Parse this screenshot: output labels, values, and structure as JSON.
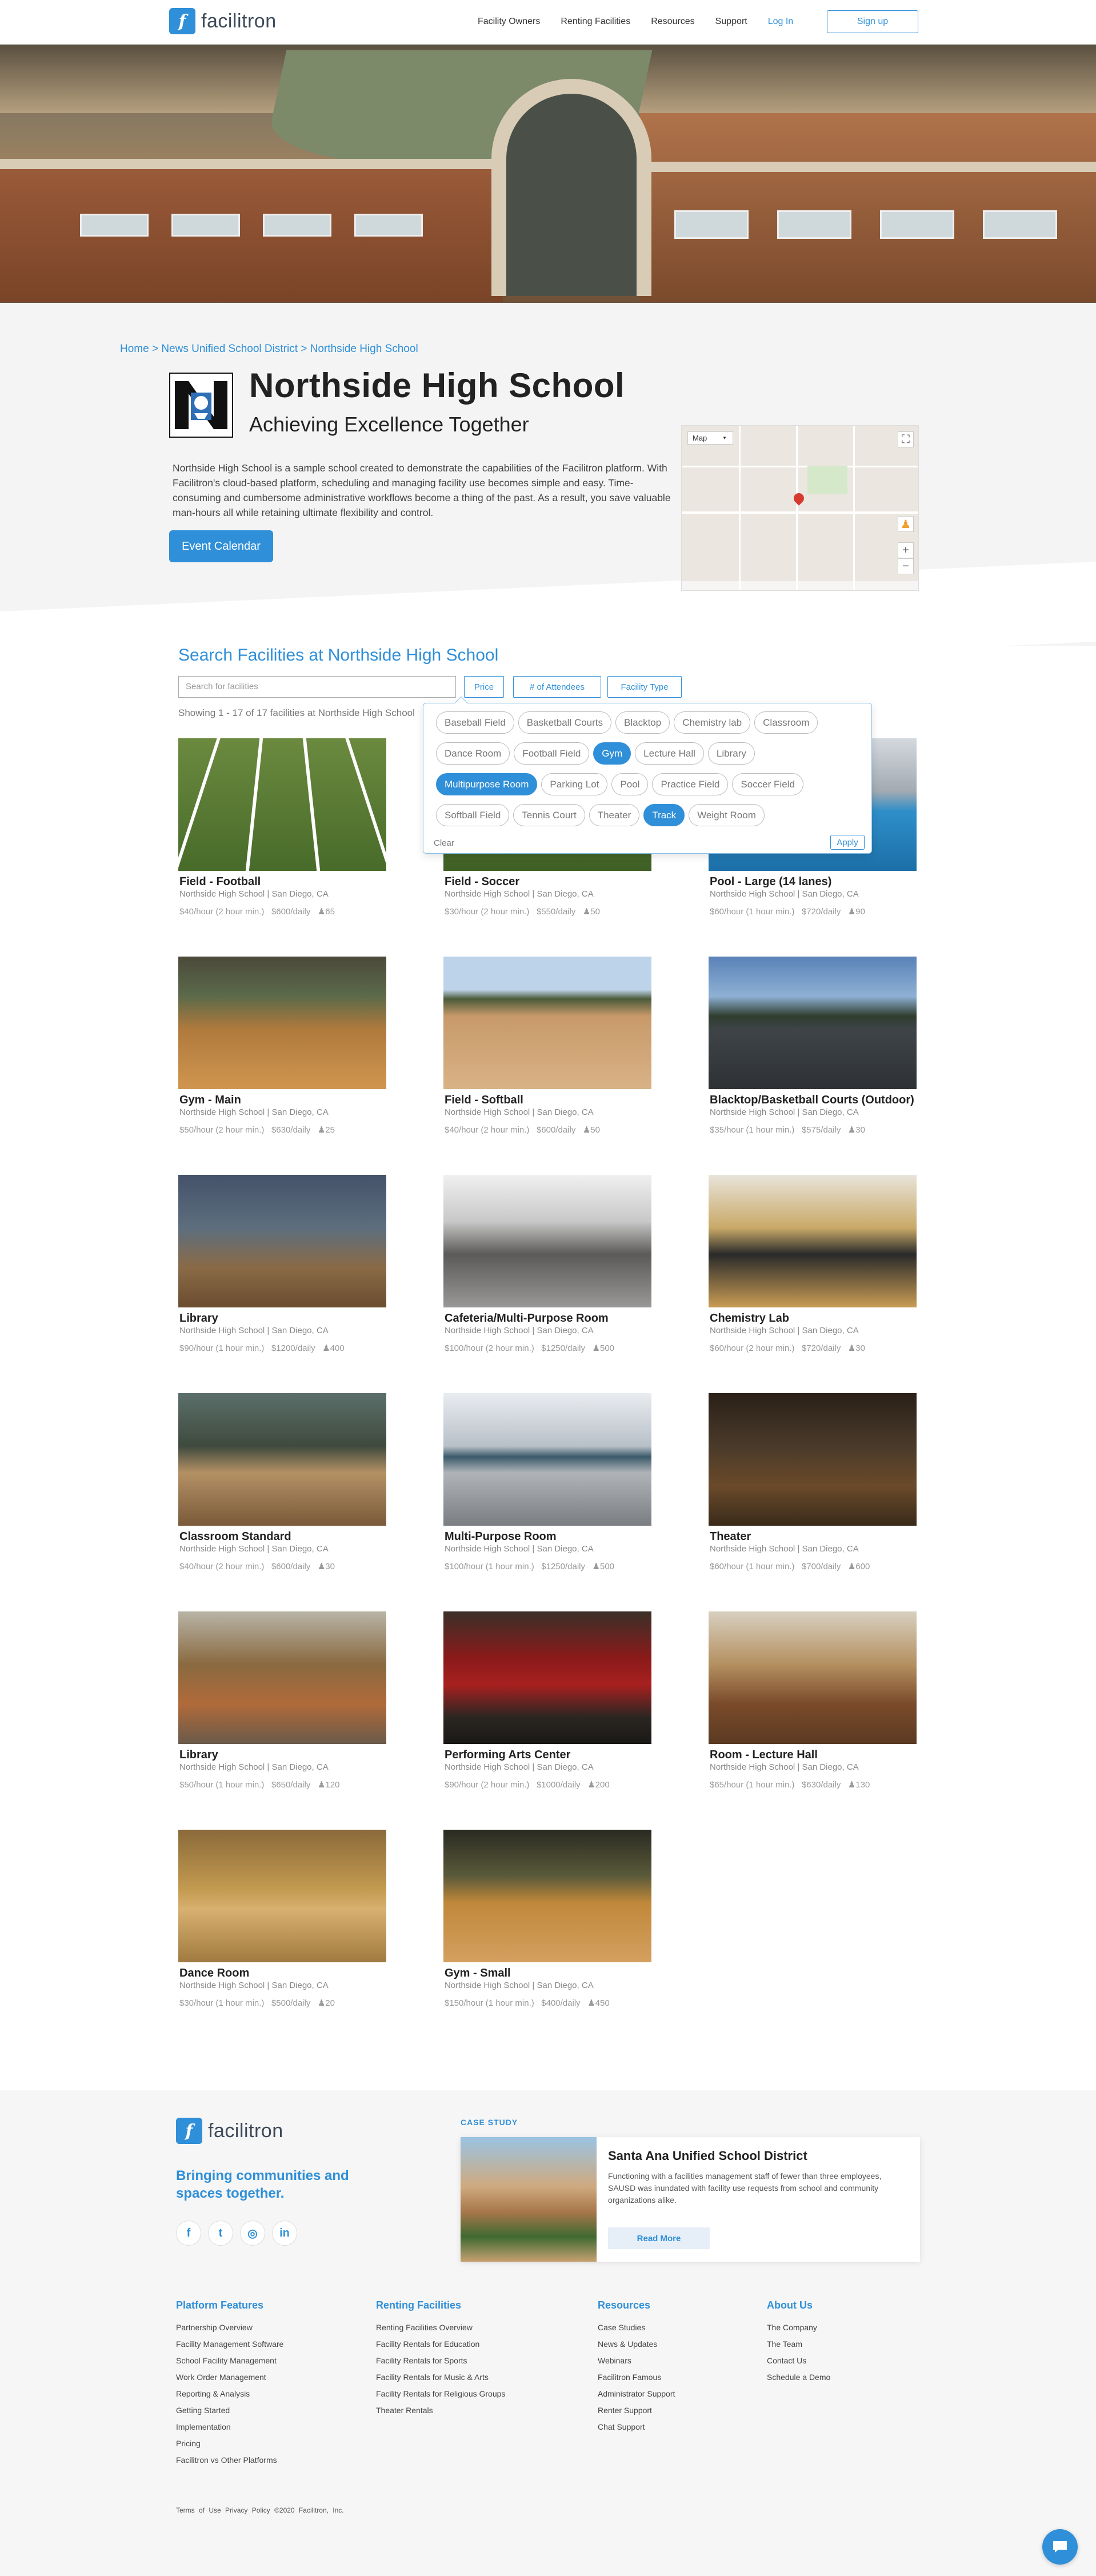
{
  "header": {
    "logo_text": "facilitron",
    "nav": [
      "Facility Owners",
      "Renting Facilities",
      "Resources",
      "Support"
    ],
    "login": "Log In",
    "signup": "Sign up"
  },
  "breadcrumb": "Home > News Unified School District > Northside High School",
  "school": {
    "name": "Northside High School",
    "tagline": "Achieving Excellence Together",
    "description": "Northside High School is a sample school created to demonstrate the capabilities of the Facilitron platform. With Facilitron's cloud-based platform, scheduling and managing facility use becomes simple and easy. Time-consuming and cumbersome administrative workflows become a thing of the past. As a result, you  save valuable man-hours all while retaining ultimate flexibility and control.",
    "event_calendar": "Event Calendar"
  },
  "map": {
    "label": "Map",
    "zoom_in": "+",
    "zoom_out": "−"
  },
  "search": {
    "title": "Search Facilities at Northside High School",
    "placeholder": "Search for facilities",
    "filters": [
      "Price",
      "# of Attendees",
      "Facility Type"
    ],
    "showing": "Showing 1 - 17 of 17 facilities at Northside High School",
    "facility_types": [
      {
        "label": "Baseball Field",
        "selected": false
      },
      {
        "label": "Basketball Courts",
        "selected": false
      },
      {
        "label": "Blacktop",
        "selected": false
      },
      {
        "label": "Chemistry lab",
        "selected": false
      },
      {
        "label": "Classroom",
        "selected": false
      },
      {
        "label": "Dance Room",
        "selected": false
      },
      {
        "label": "Football Field",
        "selected": false
      },
      {
        "label": "Gym",
        "selected": true
      },
      {
        "label": "Lecture Hall",
        "selected": false
      },
      {
        "label": "Library",
        "selected": false
      },
      {
        "label": "Multipurpose Room",
        "selected": true
      },
      {
        "label": "Parking Lot",
        "selected": false
      },
      {
        "label": "Pool",
        "selected": false
      },
      {
        "label": "Practice Field",
        "selected": false
      },
      {
        "label": "Soccer Field",
        "selected": false
      },
      {
        "label": "Softball Field",
        "selected": false
      },
      {
        "label": "Tennis Court",
        "selected": false
      },
      {
        "label": "Theater",
        "selected": false
      },
      {
        "label": "Track",
        "selected": true
      },
      {
        "label": "Weight Room",
        "selected": false
      }
    ],
    "clear": "Clear",
    "apply": "Apply"
  },
  "facilities": [
    {
      "name": "Field - Football",
      "location": "Northside High School | San Diego, CA",
      "hourly": "$40/hour (2 hour min.)",
      "daily": "$600/daily",
      "capacity": "65",
      "image": "football-field"
    },
    {
      "name": "Field - Soccer",
      "location": "Northside High School | San Diego, CA",
      "hourly": "$30/hour (2 hour min.)",
      "daily": "$550/daily",
      "capacity": "50",
      "image": "soccer-field"
    },
    {
      "name": "Pool - Large (14 lanes)",
      "location": "Northside High School | San Diego, CA",
      "hourly": "$60/hour (1 hour min.)",
      "daily": "$720/daily",
      "capacity": "90",
      "image": "pool"
    },
    {
      "name": "Gym - Main",
      "location": "Northside High School | San Diego, CA",
      "hourly": "$50/hour (2 hour min.)",
      "daily": "$630/daily",
      "capacity": "25",
      "image": "gym"
    },
    {
      "name": "Field - Softball",
      "location": "Northside High School | San Diego, CA",
      "hourly": "$40/hour (2 hour min.)",
      "daily": "$600/daily",
      "capacity": "50",
      "image": "softball-field"
    },
    {
      "name": "Blacktop/Basketball Courts (Outdoor)",
      "location": "Northside High School | San Diego, CA",
      "hourly": "$35/hour (1 hour min.)",
      "daily": "$575/daily",
      "capacity": "30",
      "image": "blacktop"
    },
    {
      "name": "Library",
      "location": "Northside High School | San Diego, CA",
      "hourly": "$90/hour (1 hour min.)",
      "daily": "$1200/daily",
      "capacity": "400",
      "image": "library"
    },
    {
      "name": "Cafeteria/Multi-Purpose Room",
      "location": "Northside High School | San Diego, CA",
      "hourly": "$100/hour (2 hour min.)",
      "daily": "$1250/daily",
      "capacity": "500",
      "image": "cafeteria"
    },
    {
      "name": "Chemistry Lab",
      "location": "Northside High School | San Diego, CA",
      "hourly": "$60/hour (2 hour min.)",
      "daily": "$720/daily",
      "capacity": "30",
      "image": "chemistry-lab"
    },
    {
      "name": "Classroom Standard",
      "location": "Northside High School | San Diego, CA",
      "hourly": "$40/hour (2 hour min.)",
      "daily": "$600/daily",
      "capacity": "30",
      "image": "classroom"
    },
    {
      "name": "Multi-Purpose Room",
      "location": "Northside High School | San Diego, CA",
      "hourly": "$100/hour (1 hour min.)",
      "daily": "$1250/daily",
      "capacity": "500",
      "image": "multipurpose-room"
    },
    {
      "name": "Theater",
      "location": "Northside High School | San Diego, CA",
      "hourly": "$60/hour (1 hour min.)",
      "daily": "$700/daily",
      "capacity": "600",
      "image": "theater"
    },
    {
      "name": "Library",
      "location": "Northside High School | San Diego, CA",
      "hourly": "$50/hour (1 hour min.)",
      "daily": "$650/daily",
      "capacity": "120",
      "image": "library-2"
    },
    {
      "name": "Performing Arts Center",
      "location": "Northside High School | San Diego, CA",
      "hourly": "$90/hour (2 hour min.)",
      "daily": "$1000/daily",
      "capacity": "200",
      "image": "performing-arts"
    },
    {
      "name": "Room - Lecture Hall",
      "location": "Northside High School | San Diego, CA",
      "hourly": "$65/hour (1 hour min.)",
      "daily": "$630/daily",
      "capacity": "130",
      "image": "lecture-hall"
    },
    {
      "name": "Dance Room",
      "location": "Northside High School | San Diego, CA",
      "hourly": "$30/hour (1 hour min.)",
      "daily": "$500/daily",
      "capacity": "20",
      "image": "dance-room"
    },
    {
      "name": "Gym - Small",
      "location": "Northside High School | San Diego, CA",
      "hourly": "$150/hour (1 hour min.)",
      "daily": "$400/daily",
      "capacity": "450",
      "image": "gym-small"
    }
  ],
  "footer": {
    "logo_text": "facilitron",
    "tagline": "Bringing communities and spaces together.",
    "social": [
      "facebook-icon",
      "twitter-icon",
      "instagram-icon",
      "linkedin-icon"
    ],
    "case_study": {
      "label": "CASE STUDY",
      "title": "Santa Ana Unified School District",
      "description": "Functioning with a facilities management staff of fewer than three employees, SAUSD was inundated with facility use requests from school and community organizations alike.",
      "button": "Read More"
    },
    "columns": [
      {
        "title": "Platform Features",
        "links": [
          "Partnership Overview",
          "Facility Management Software",
          "School Facility Management",
          "Work Order Management",
          "Reporting & Analysis",
          "Getting Started",
          "Implementation",
          "Pricing",
          "Facilitron vs Other Platforms"
        ]
      },
      {
        "title": "Renting Facilities",
        "links": [
          "Renting Facilities Overview",
          "Facility Rentals for Education",
          "Facility Rentals for Sports",
          "Facility Rentals for Music & Arts",
          "Facility Rentals for Religious Groups",
          "Theater Rentals"
        ]
      },
      {
        "title": "Resources",
        "links": [
          "Case Studies",
          "News & Updates",
          "Webinars",
          "Facilitron Famous",
          "Administrator Support",
          "Renter Support",
          "Chat Support"
        ]
      },
      {
        "title": "About Us",
        "links": [
          "The Company",
          "The Team",
          "Contact Us",
          "Schedule a Demo"
        ]
      }
    ],
    "legal": [
      "Terms of Use",
      "Privacy Policy",
      "©2020 Facilitron, Inc."
    ]
  }
}
